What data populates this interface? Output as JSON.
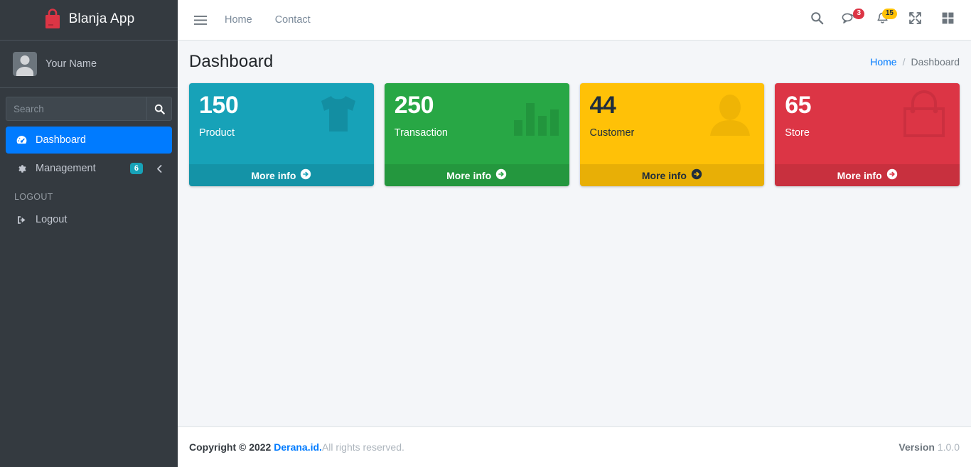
{
  "sidebar": {
    "brand": {
      "icon": "shopping-bag-icon",
      "title": "Blanja App",
      "color": "#dc3545"
    },
    "user": {
      "name": "Your Name",
      "avatar": "user-avatar-icon"
    },
    "search": {
      "placeholder": "Search",
      "value": "",
      "button_icon": "search-icon"
    },
    "items": [
      {
        "label": "Dashboard",
        "icon": "tachometer-icon",
        "active": true
      },
      {
        "label": "Management",
        "icon": "gear-icon",
        "badge": "6",
        "chevron": "chevron-left-icon",
        "active": false
      }
    ],
    "section_header": "LOGOUT",
    "logout": {
      "label": "Logout",
      "icon": "sign-out-icon"
    }
  },
  "topbar": {
    "menu_icon": "hamburger-menu-icon",
    "links": [
      {
        "label": "Home"
      },
      {
        "label": "Contact"
      }
    ],
    "right_icons": [
      {
        "name": "search-icon",
        "badge": null
      },
      {
        "name": "comments-icon",
        "badge": "3",
        "badge_color": "#dc3545"
      },
      {
        "name": "bell-icon",
        "badge": "15",
        "badge_color": "#ffc107"
      },
      {
        "name": "expand-arrows-icon",
        "badge": null
      },
      {
        "name": "grid-squares-icon",
        "badge": null
      }
    ]
  },
  "content": {
    "page_title": "Dashboard",
    "breadcrumb": {
      "home": "Home",
      "separator": "/",
      "current": "Dashboard"
    },
    "cards": [
      {
        "number": "150",
        "text": "Product",
        "more_info": "More info",
        "icon": "tshirt-icon",
        "color": "#17a2b8",
        "theme": "sb-teal"
      },
      {
        "number": "250",
        "text": "Transaction",
        "more_info": "More info",
        "icon": "bar-chart-icon",
        "color": "#28a745",
        "theme": "sb-green"
      },
      {
        "number": "44",
        "text": "Customer",
        "more_info": "More info",
        "icon": "user-icon",
        "color": "#ffc107",
        "theme": "sb-yellow"
      },
      {
        "number": "65",
        "text": "Store",
        "more_info": "More info",
        "icon": "shopping-bag-icon",
        "color": "#dc3545",
        "theme": "sb-red"
      }
    ]
  },
  "footer": {
    "copyright_prefix": "Copyright © 2022 ",
    "company": "Derana.id.",
    "rights": "All rights reserved.",
    "version_label": "Version",
    "version_number": "1.0.0"
  }
}
